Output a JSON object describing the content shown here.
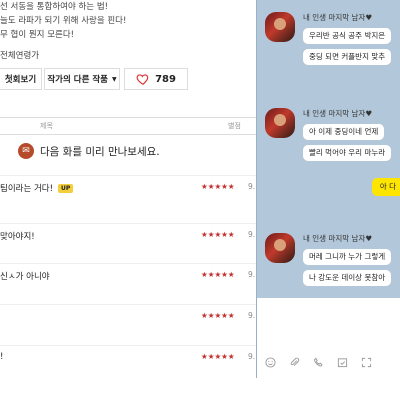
{
  "summary": {
    "lines": [
      "선 서동을 통합하여야 하는 법!",
      "늘도 라파가 되기 위해 사랑을 핀다!",
      "무 협이 뭔지 모른다!"
    ],
    "meta": "전체연령가"
  },
  "buttons": {
    "first_view": "첫회보기",
    "other_works": "작가의 다른 작품",
    "like_count": "789"
  },
  "table_header": {
    "title": "제목",
    "rating": "별점"
  },
  "preview": {
    "text": "다음 화를 미리 만나보세요."
  },
  "episodes": [
    {
      "title": "팀이라는 거다!",
      "badge": "UP",
      "stars": "★★★★★",
      "rating": "9."
    },
    {
      "title": "맞아야지!",
      "badge": "",
      "stars": "★★★★★",
      "rating": "9."
    },
    {
      "title": "신ㅅ가 아니야",
      "badge": "",
      "stars": "★★★★★",
      "rating": "9."
    },
    {
      "title": "",
      "badge": "",
      "stars": "★★★★★",
      "rating": "9."
    },
    {
      "title": "!",
      "badge": "",
      "stars": "★★★★★",
      "rating": "9."
    }
  ],
  "chat": {
    "groups": [
      {
        "sender": "내 인생 마지막 남자♥",
        "bubbles": [
          "우리반 공식 공주 박지은",
          "중딩 되면 커플반지 맞추"
        ]
      },
      {
        "sender": "내 인생 마지막 남자♥",
        "bubbles": [
          "아 이제 중딩이네 언제 ",
          "빨리 먹어야 우리 마누라"
        ]
      },
      {
        "sender": "내 인생 마지막 남자♥",
        "bubbles": [
          "머레 그니까 누가 그렇게",
          "나 강도운 데이상 못참아"
        ]
      }
    ],
    "my_message": "아 다",
    "accent": "#fee500",
    "background": "#b2c7d9"
  },
  "icons": [
    "heart-icon",
    "emoji-icon",
    "attach-icon",
    "phone-icon",
    "calendar-check-icon",
    "expand-icon"
  ]
}
